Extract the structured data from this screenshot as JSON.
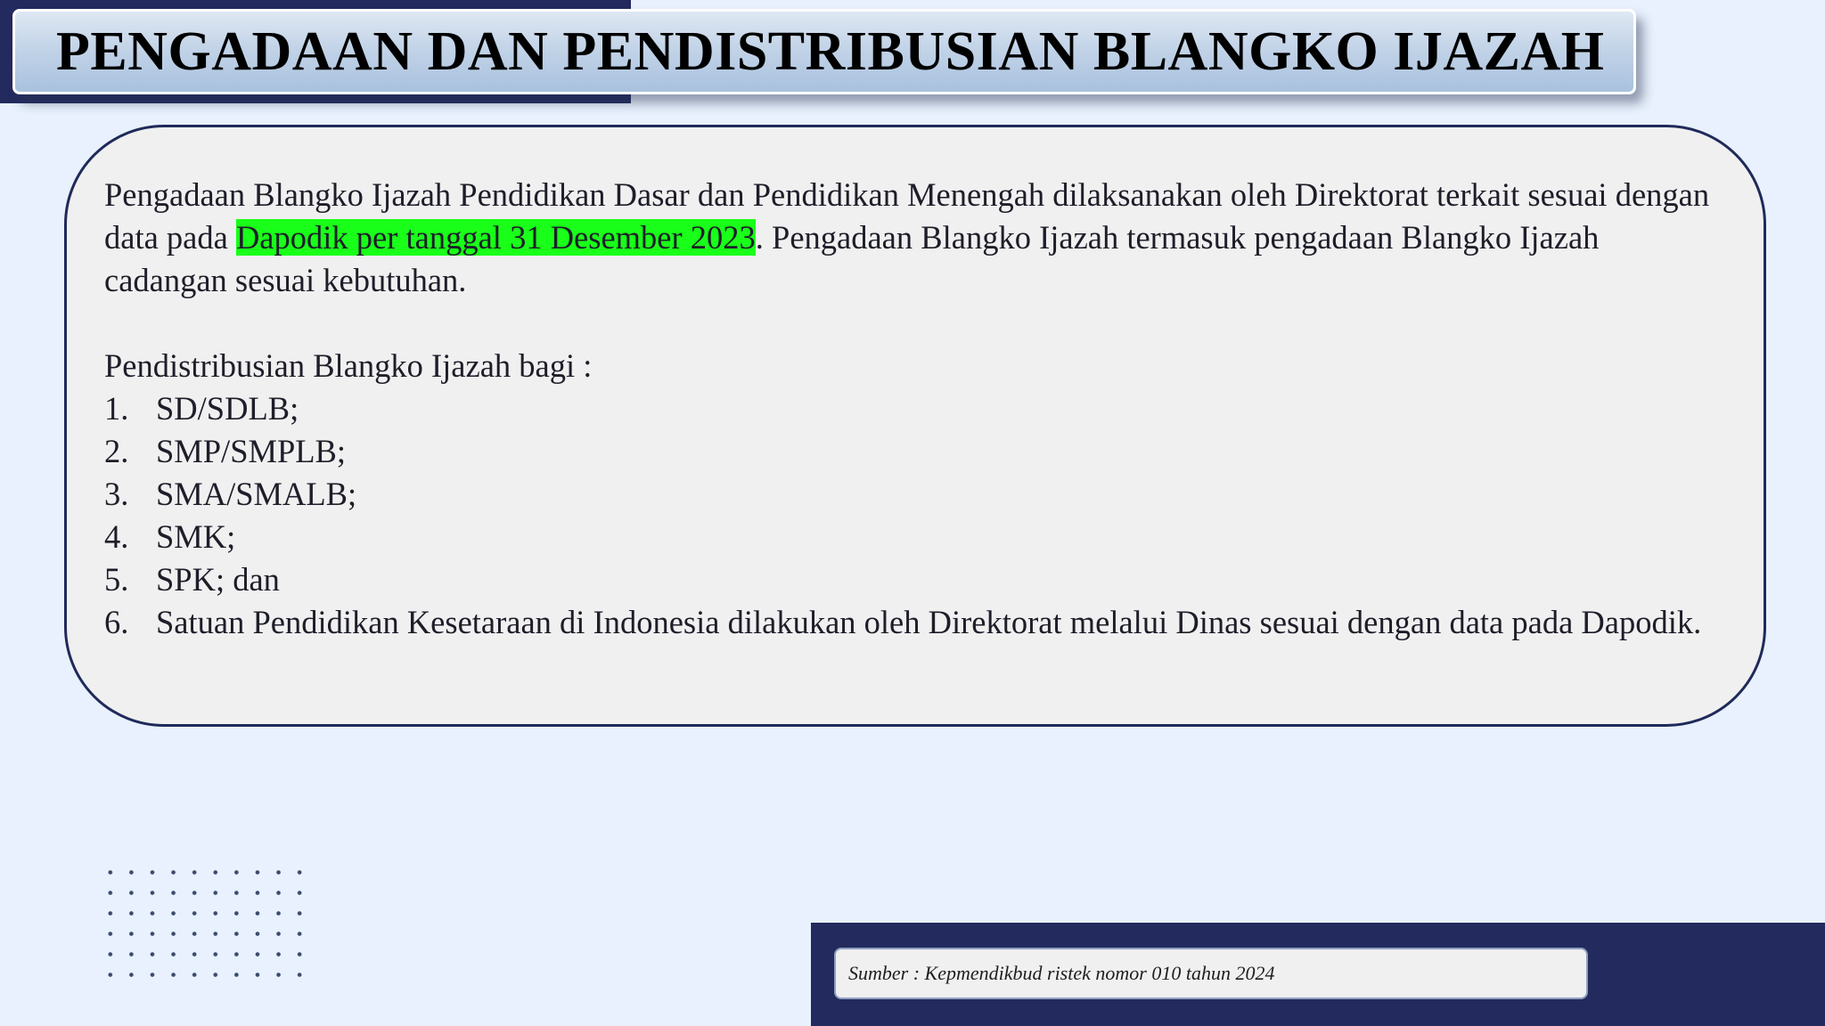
{
  "header": {
    "title": "PENGADAAN DAN PENDISTRIBUSIAN BLANGKO IJAZAH"
  },
  "content": {
    "paragraph_before": "Pengadaan Blangko Ijazah Pendidikan Dasar dan Pendidikan Menengah dilaksanakan oleh Direktorat terkait sesuai dengan data pada ",
    "paragraph_highlight": "Dapodik per tanggal 31 Desember 2023",
    "paragraph_after": ". Pengadaan Blangko Ijazah termasuk pengadaan Blangko Ijazah cadangan sesuai kebutuhan.",
    "highlight_color": "#19ff19",
    "list_intro": "Pendistribusian Blangko Ijazah bagi :",
    "list_items": [
      {
        "num": "1.",
        "text": "SD/SDLB;"
      },
      {
        "num": "2.",
        "text": "SMP/SMPLB;"
      },
      {
        "num": "3.",
        "text": "SMA/SMALB;"
      },
      {
        "num": "4.",
        "text": "SMK;"
      },
      {
        "num": "5.",
        "text": "SPK; dan"
      },
      {
        "num": "6.",
        "text": "Satuan Pendidikan Kesetaraan di Indonesia dilakukan oleh Direktorat melalui Dinas sesuai dengan data pada Dapodik."
      }
    ]
  },
  "footer": {
    "source": "Sumber : Kepmendikbud ristek nomor 010 tahun 2024"
  },
  "colors": {
    "navy": "#232a5e",
    "background": "#e8f1fd",
    "content_box": "#f0f0f0"
  }
}
